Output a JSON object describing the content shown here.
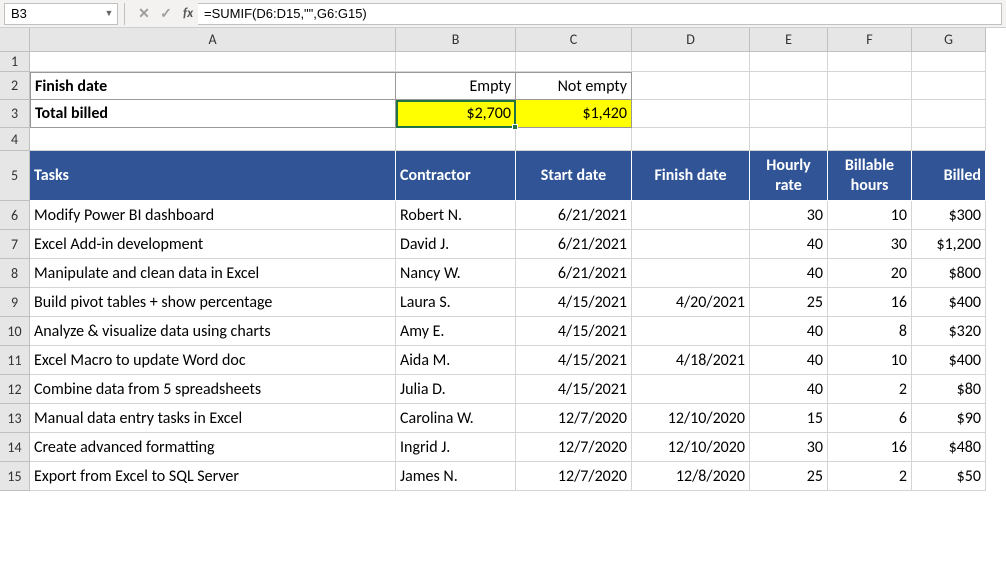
{
  "active_cell": "B3",
  "formula": "=SUMIF(D6:D15,\"\",G6:G15)",
  "cols": [
    "A",
    "B",
    "C",
    "D",
    "E",
    "F",
    "G"
  ],
  "row_numbers": [
    1,
    2,
    3,
    4,
    5,
    6,
    7,
    8,
    9,
    10,
    11,
    12,
    13,
    14,
    15
  ],
  "summary": {
    "finish_label": "Finish date",
    "total_label": "Total billed",
    "empty_label": "Empty",
    "notempty_label": "Not empty",
    "empty_total": "$2,700",
    "notempty_total": "$1,420"
  },
  "table": {
    "headers": {
      "tasks": "Tasks",
      "contractor": "Contractor",
      "start": "Start date",
      "finish": "Finish date",
      "rate": "Hourly rate",
      "hours": "Billable hours",
      "billed": "Billed"
    },
    "rows": [
      {
        "task": "Modify Power BI dashboard",
        "contractor": "Robert N.",
        "start": "6/21/2021",
        "finish": "",
        "rate": "30",
        "hours": "10",
        "billed": "$300"
      },
      {
        "task": "Excel Add-in development",
        "contractor": "David J.",
        "start": "6/21/2021",
        "finish": "",
        "rate": "40",
        "hours": "30",
        "billed": "$1,200"
      },
      {
        "task": "Manipulate and clean data in Excel",
        "contractor": "Nancy W.",
        "start": "6/21/2021",
        "finish": "",
        "rate": "40",
        "hours": "20",
        "billed": "$800"
      },
      {
        "task": "Build pivot tables + show percentage",
        "contractor": "Laura S.",
        "start": "4/15/2021",
        "finish": "4/20/2021",
        "rate": "25",
        "hours": "16",
        "billed": "$400"
      },
      {
        "task": "Analyze & visualize data using charts",
        "contractor": "Amy E.",
        "start": "4/15/2021",
        "finish": "",
        "rate": "40",
        "hours": "8",
        "billed": "$320"
      },
      {
        "task": "Excel Macro to update Word doc",
        "contractor": "Aida M.",
        "start": "4/15/2021",
        "finish": "4/18/2021",
        "rate": "40",
        "hours": "10",
        "billed": "$400"
      },
      {
        "task": "Combine data from 5 spreadsheets",
        "contractor": "Julia D.",
        "start": "4/15/2021",
        "finish": "",
        "rate": "40",
        "hours": "2",
        "billed": "$80"
      },
      {
        "task": "Manual data entry tasks in Excel",
        "contractor": "Carolina W.",
        "start": "12/7/2020",
        "finish": "12/10/2020",
        "rate": "15",
        "hours": "6",
        "billed": "$90"
      },
      {
        "task": "Create advanced formatting",
        "contractor": "Ingrid J.",
        "start": "12/7/2020",
        "finish": "12/10/2020",
        "rate": "30",
        "hours": "16",
        "billed": "$480"
      },
      {
        "task": "Export from Excel to SQL Server",
        "contractor": "James N.",
        "start": "12/7/2020",
        "finish": "12/8/2020",
        "rate": "25",
        "hours": "2",
        "billed": "$50"
      }
    ]
  }
}
